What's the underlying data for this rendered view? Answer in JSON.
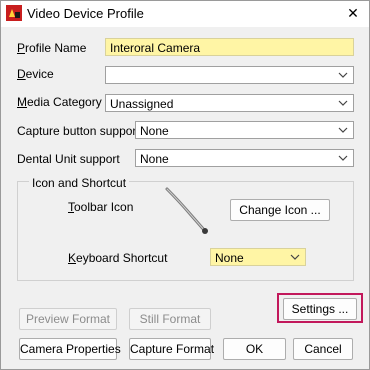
{
  "window": {
    "title": "Video Device Profile",
    "close_glyph": "✕"
  },
  "form": {
    "profile_name": {
      "label_first": "P",
      "label_rest": "rofile Name",
      "value": "Interoral Camera"
    },
    "device": {
      "label_first": "D",
      "label_rest": "evice",
      "value": ""
    },
    "media_category": {
      "label_first": "M",
      "label_rest": "edia Category",
      "value": "Unassigned"
    },
    "capture_button": {
      "label": "Capture button support",
      "value": "None"
    },
    "dental_unit": {
      "label": "Dental Unit support",
      "value": "None"
    }
  },
  "icon_shortcut": {
    "legend": "Icon and Shortcut",
    "toolbar_icon_label_first": "T",
    "toolbar_icon_label_rest": "oolbar Icon",
    "toolbar_icon_name": "dental-camera-wand-icon",
    "change_icon_label": "Change Icon ...",
    "keyboard_label_first": "K",
    "keyboard_label_rest": "eyboard Shortcut",
    "keyboard_value": "None"
  },
  "buttons": {
    "settings": "Settings ...",
    "preview_format": "Preview Format",
    "still_format": "Still Format",
    "camera_properties": "Camera Properties",
    "capture_format": "Capture Format",
    "ok": "OK",
    "cancel": "Cancel"
  },
  "colors": {
    "highlight_border": "#c2185b",
    "required_field_bg": "#fff5a5"
  }
}
